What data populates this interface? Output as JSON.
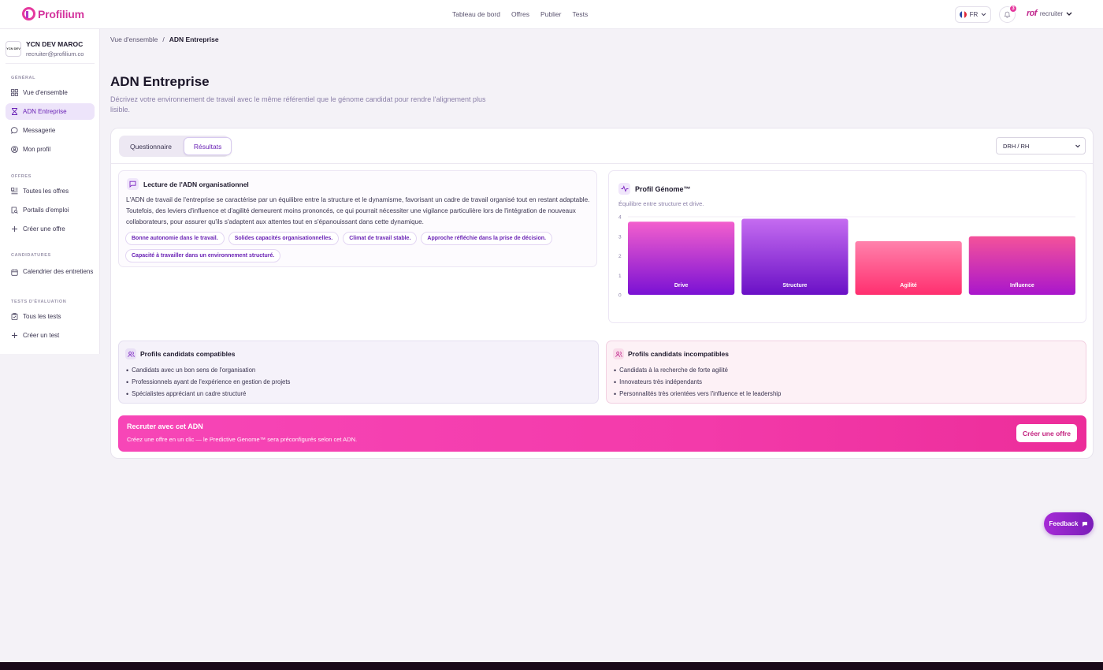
{
  "brand": {
    "name": "Profilium"
  },
  "topnav": [
    "Tableau de bord",
    "Offres",
    "Publier",
    "Tests"
  ],
  "lang": "FR",
  "notifications": {
    "count": "3"
  },
  "user": {
    "logo_text": "rof",
    "name": "recruiter"
  },
  "company": {
    "logo_text": "YCN DEV",
    "name": "YCN DEV MAROC",
    "email": "recruiter@profilium.co"
  },
  "sidebar": {
    "sections": {
      "general": "GÉNÉRAL",
      "offres": "OFFRES",
      "candidatures": "CANDIDATURES",
      "tests": "TESTS D'ÉVALUATION"
    },
    "items": {
      "overview": "Vue d'ensemble",
      "adn": "ADN Entreprise",
      "messaging": "Messagerie",
      "profile": "Mon profil",
      "all_offers": "Toutes les offres",
      "job_portals": "Portails d'emploi",
      "create_offer": "Créer une offre",
      "calendar": "Calendrier des entretiens",
      "all_tests": "Tous les tests",
      "create_test": "Créer un test"
    }
  },
  "breadcrumb": {
    "root": "Vue d'ensemble",
    "sep": "/",
    "current": "ADN Entreprise"
  },
  "page": {
    "title": "ADN Entreprise",
    "subtitle": "Décrivez votre environnement de travail avec le même référentiel que le génome candidat pour rendre l'alignement plus lisible."
  },
  "tabs": {
    "questionnaire": "Questionnaire",
    "results": "Résultats"
  },
  "select": {
    "value": "DRH / RH"
  },
  "lecture": {
    "title": "Lecture de l'ADN organisationnel",
    "text": "L'ADN de travail de l'entreprise se caractérise par un équilibre entre la structure et le dynamisme, favorisant un cadre de travail organisé tout en restant adaptable. Toutefois, des leviers d'influence et d'agilité demeurent moins prononcés, ce qui pourrait nécessiter une vigilance particulière lors de l'intégration de nouveaux collaborateurs, pour assurer qu'ils s'adaptent aux attentes tout en s'épanouissant dans cette dynamique.",
    "chips": [
      "Bonne autonomie dans le travail.",
      "Solides capacités organisationnelles.",
      "Climat de travail stable.",
      "Approche réfléchie dans la prise de décision.",
      "Capacité à travailler dans un environnement structuré."
    ]
  },
  "genome": {
    "title": "Profil Génome™",
    "subtitle": "Équilibre entre structure et drive."
  },
  "chart_data": {
    "type": "bar",
    "categories": [
      "Drive",
      "Structure",
      "Agilité",
      "Influence"
    ],
    "values": [
      3.75,
      3.9,
      2.75,
      3.0
    ],
    "ylim": [
      0,
      4
    ],
    "yticks": [
      "0",
      "1",
      "2",
      "3",
      "4"
    ],
    "colors": [
      [
        "#f35fcd",
        "#7a11d4"
      ],
      [
        "#c56cf0",
        "#6a10c6"
      ],
      [
        "#ff82ac",
        "#ff2f6f"
      ],
      [
        "#f4529a",
        "#a916cc"
      ]
    ]
  },
  "compatible": {
    "title": "Profils candidats compatibles",
    "items": [
      "Candidats avec un bon sens de l'organisation",
      "Professionnels ayant de l'expérience en gestion de projets",
      "Spécialistes appréciant un cadre structuré"
    ]
  },
  "incompatible": {
    "title": "Profils candidats incompatibles",
    "items": [
      "Candidats à la recherche de forte agilité",
      "Innovateurs très indépendants",
      "Personnalités très orientées vers l'influence et le leadership"
    ]
  },
  "cta": {
    "title": "Recruter avec cet ADN",
    "subtitle": "Créez une offre en un clic — le Predictive Genome™ sera préconfigurés selon cet ADN.",
    "button": "Créer une offre"
  },
  "feedback": {
    "label": "Feedback"
  }
}
